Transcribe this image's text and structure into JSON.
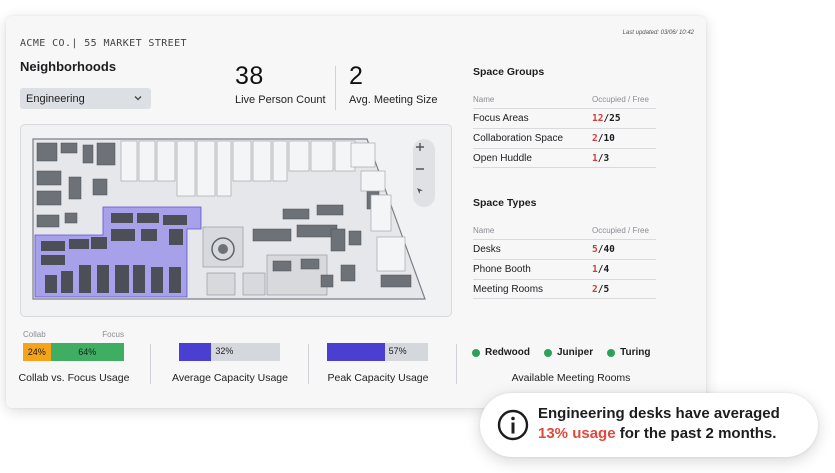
{
  "header": {
    "last_updated": "Last updated: 03/06/ 10:42",
    "company": "ACME CO.| 55 MARKET STREET",
    "neighborhoods_title": "Neighborhoods",
    "neighborhood_selected": "Engineering"
  },
  "kpis": {
    "live_count": "38",
    "live_count_label": "Live Person Count",
    "avg_meeting": "2",
    "avg_meeting_label": "Avg. Meeting Size"
  },
  "space_groups": {
    "title": "Space Groups",
    "col_name": "Name",
    "col_status": "Occupied / Free",
    "rows": [
      {
        "name": "Focus Areas",
        "occupied": "12",
        "free": "/25"
      },
      {
        "name": "Collaboration Space",
        "occupied": "2",
        "free": "/10"
      },
      {
        "name": "Open Huddle",
        "occupied": "1",
        "free": "/3"
      }
    ]
  },
  "space_types": {
    "title": "Space Types",
    "col_name": "Name",
    "col_status": "Occupied / Free",
    "rows": [
      {
        "name": "Desks",
        "occupied": "5",
        "free": "/40"
      },
      {
        "name": "Phone Booth",
        "occupied": "1",
        "free": "/4"
      },
      {
        "name": "Meeting Rooms",
        "occupied": "2",
        "free": "/5"
      }
    ]
  },
  "usage": {
    "collab_label": "Collab",
    "focus_label": "Focus",
    "collab_pct": "24%",
    "focus_pct": "64%",
    "collab_fraction": 0.24,
    "focus_fraction": 0.64,
    "collab_color": "#f5a31a",
    "focus_color": "#3fae62",
    "collab_focus_title": "Collab vs. Focus Usage",
    "avg_capacity_pct": "32%",
    "avg_capacity_fraction": 0.32,
    "avg_capacity_title": "Average Capacity Usage",
    "peak_capacity_pct": "57%",
    "peak_capacity_fraction": 0.57,
    "peak_capacity_title": "Peak Capacity Usage",
    "capacity_color": "#4b3fd1"
  },
  "meeting_rooms": {
    "title": "Available Meeting Rooms",
    "rooms": [
      "Redwood",
      "Juniper",
      "Turing"
    ],
    "dot_color": "#2fa05a"
  },
  "map": {
    "zoom_in_icon": "plus-icon",
    "zoom_out_icon": "minus-icon",
    "locate_icon": "compass-icon",
    "highlight_color": "#8f86ea"
  },
  "toast": {
    "icon": "info-icon",
    "line1": "Engineering desks have averaged",
    "highlight": "13% usage",
    "line2_rest": " for the past 2 months.",
    "highlight_color": "#e2483b"
  }
}
